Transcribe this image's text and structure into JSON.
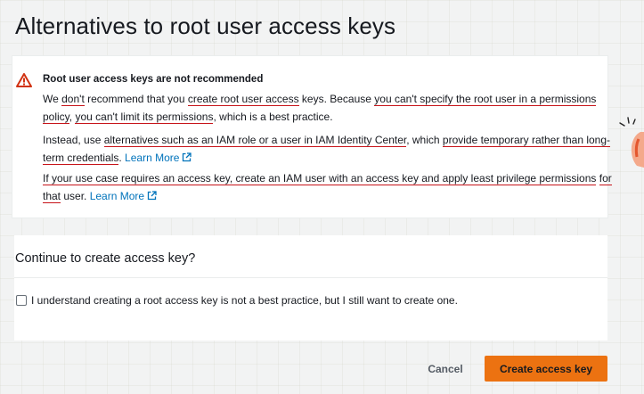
{
  "page": {
    "title": "Alternatives to root user access keys"
  },
  "alert": {
    "icon": "warning-triangle-icon",
    "heading": "Root user access keys are not recommended",
    "p1": {
      "a": "We ",
      "b": "don't",
      "c": " recommend that you ",
      "d": "create root user access",
      "e": " keys. Because ",
      "f": "you can't specify the root user in a permissions policy",
      "g": ", ",
      "h": "you can't limit its permissions",
      "i": ", which is a best practice."
    },
    "p2": {
      "a": "Instead, use ",
      "b": "alternatives such as an IAM role or a user in IAM Identity Center",
      "c": ", which ",
      "d": "provide temporary rather than long-term credentials",
      "e": ". ",
      "link": "Learn More"
    },
    "p3": {
      "a": "If your use case requires an access key, create an IAM user with an access key and apply least privilege permissions",
      "b": " ",
      "c": "for that",
      "d": " user. ",
      "link": "Learn More"
    },
    "external_icon": "external-link-icon",
    "accent_color": "#d13212"
  },
  "confirm": {
    "heading": "Continue to create access key?",
    "checkbox_label": "I understand creating a root access key is not a best practice, but I still want to create one.",
    "checked": false
  },
  "footer": {
    "cancel_label": "Cancel",
    "create_label": "Create access key",
    "primary_color": "#ec7211"
  }
}
